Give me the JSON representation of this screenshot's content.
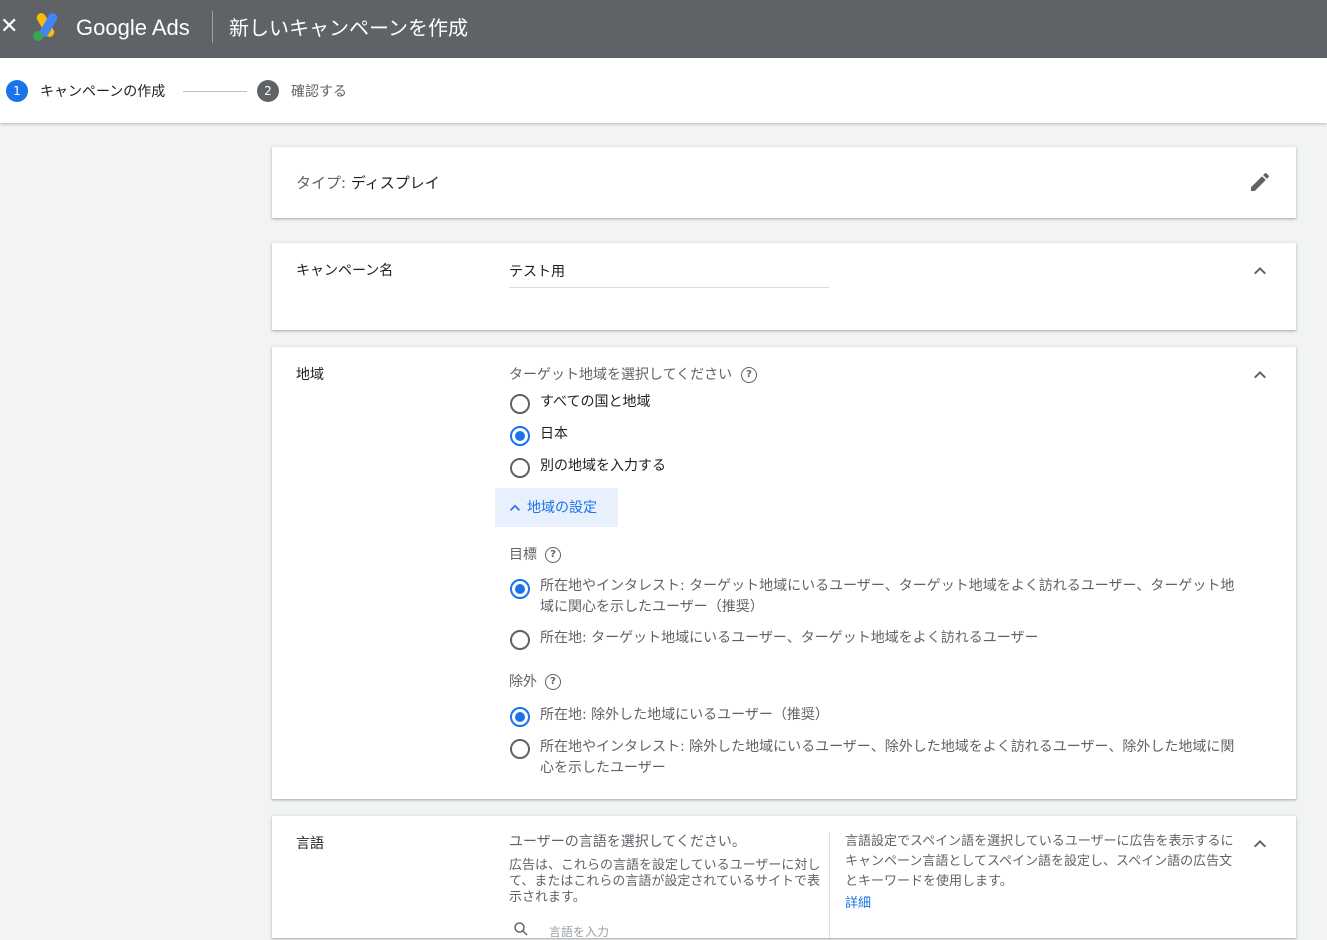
{
  "header": {
    "close_icon": "close-icon",
    "brand": "Google Ads",
    "title": "新しいキャンペーンを作成"
  },
  "stepper": {
    "steps": [
      {
        "number": "1",
        "label": "キャンペーンの作成",
        "active": true
      },
      {
        "number": "2",
        "label": "確認する",
        "active": false
      }
    ]
  },
  "type_card": {
    "label": "タイプ:",
    "value": "ディスプレイ",
    "edit_icon": "pencil-icon"
  },
  "name_card": {
    "label": "キャンペーン名",
    "value": "テスト用",
    "collapse_icon": "chevron-up-icon"
  },
  "location_card": {
    "label": "地域",
    "prompt": "ターゲット地域を選択してください",
    "options": [
      "すべての国と地域",
      "日本",
      "別の地域を入力する"
    ],
    "selected_option": "日本",
    "settings_button": "地域の設定",
    "target": {
      "label": "目標",
      "options": [
        "所在地やインタレスト: ターゲット地域にいるユーザー、ターゲット地域をよく訪れるユーザー、ターゲット地域に関心を示したユーザー（推奨）",
        "所在地: ターゲット地域にいるユーザー、ターゲット地域をよく訪れるユーザー"
      ],
      "selected_index": 0
    },
    "exclude": {
      "label": "除外",
      "options": [
        "所在地: 除外した地域にいるユーザー（推奨）",
        "所在地やインタレスト: 除外した地域にいるユーザー、除外した地域をよく訪れるユーザー、除外した地域に関心を示したユーザー"
      ],
      "selected_index": 0
    }
  },
  "language_card": {
    "label": "言語",
    "prompt": "ユーザーの言語を選択してください。",
    "description": "広告は、これらの言語を設定しているユーザーに対して、またはこれらの言語が設定されているサイトで表示されます。",
    "search_placeholder": "言語を入力",
    "help_text": "言語設定でスペイン語を選択しているユーザーに広告を表示するにキャンペーン言語としてスペイン語を設定し、スペイン語の広告文とキーワードを使用します。",
    "details_link": "詳細"
  },
  "colors": {
    "topbar": "#5f6368",
    "accent": "#1a73e8",
    "step_inactive": "#5f6368"
  }
}
